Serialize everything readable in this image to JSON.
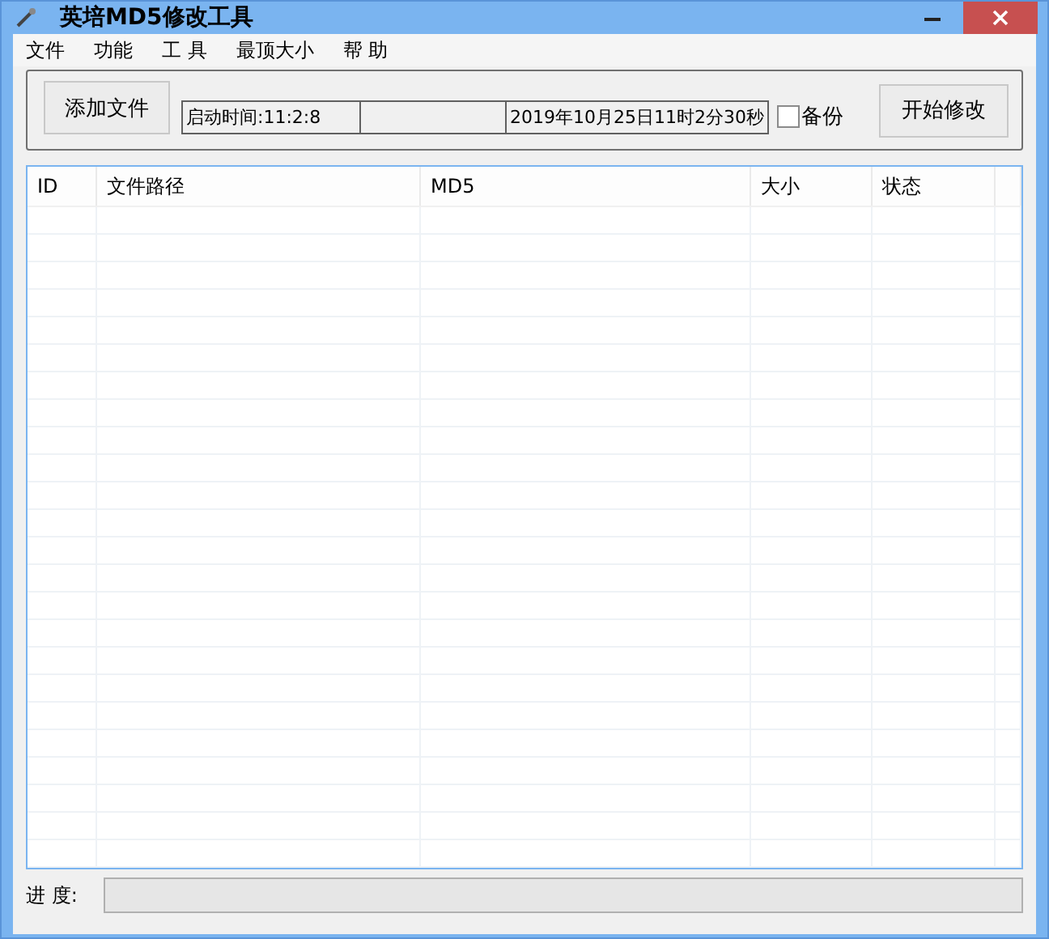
{
  "window": {
    "title": "英培MD5修改工具"
  },
  "menu": [
    "文件",
    "功能",
    "工 具",
    "最顶大小",
    "帮 助"
  ],
  "toolbar": {
    "add_button": "添加文件",
    "status_panels": [
      {
        "kind": "text",
        "text": "启动时间:11:2:8"
      },
      {
        "kind": "blank"
      },
      {
        "kind": "text",
        "text": "2019年10月25日11时2分30秒"
      }
    ],
    "backup": {
      "label": "备份",
      "checked": false
    },
    "start_button": "开始修改"
  },
  "table": {
    "columns": [
      "ID",
      "文件路径",
      "MD5",
      "大小",
      "状态"
    ]
  },
  "progress": {
    "label": "进 度:",
    "level": 0
  }
}
